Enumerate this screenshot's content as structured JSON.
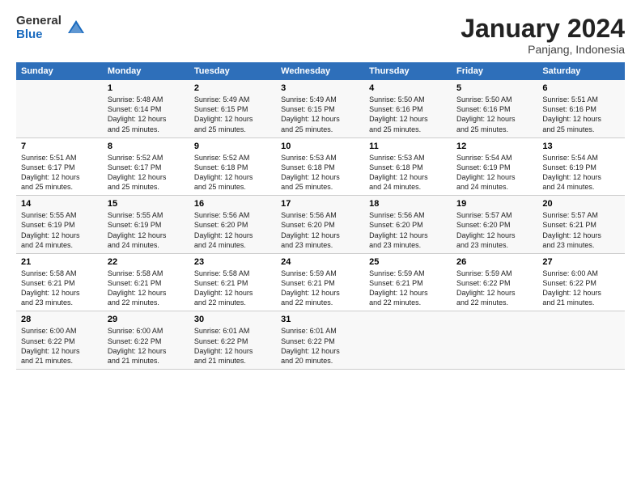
{
  "logo": {
    "general": "General",
    "blue": "Blue"
  },
  "title": "January 2024",
  "subtitle": "Panjang, Indonesia",
  "days_header": [
    "Sunday",
    "Monday",
    "Tuesday",
    "Wednesday",
    "Thursday",
    "Friday",
    "Saturday"
  ],
  "weeks": [
    [
      {
        "num": "",
        "info": ""
      },
      {
        "num": "1",
        "info": "Sunrise: 5:48 AM\nSunset: 6:14 PM\nDaylight: 12 hours\nand 25 minutes."
      },
      {
        "num": "2",
        "info": "Sunrise: 5:49 AM\nSunset: 6:15 PM\nDaylight: 12 hours\nand 25 minutes."
      },
      {
        "num": "3",
        "info": "Sunrise: 5:49 AM\nSunset: 6:15 PM\nDaylight: 12 hours\nand 25 minutes."
      },
      {
        "num": "4",
        "info": "Sunrise: 5:50 AM\nSunset: 6:16 PM\nDaylight: 12 hours\nand 25 minutes."
      },
      {
        "num": "5",
        "info": "Sunrise: 5:50 AM\nSunset: 6:16 PM\nDaylight: 12 hours\nand 25 minutes."
      },
      {
        "num": "6",
        "info": "Sunrise: 5:51 AM\nSunset: 6:16 PM\nDaylight: 12 hours\nand 25 minutes."
      }
    ],
    [
      {
        "num": "7",
        "info": "Sunrise: 5:51 AM\nSunset: 6:17 PM\nDaylight: 12 hours\nand 25 minutes."
      },
      {
        "num": "8",
        "info": "Sunrise: 5:52 AM\nSunset: 6:17 PM\nDaylight: 12 hours\nand 25 minutes."
      },
      {
        "num": "9",
        "info": "Sunrise: 5:52 AM\nSunset: 6:18 PM\nDaylight: 12 hours\nand 25 minutes."
      },
      {
        "num": "10",
        "info": "Sunrise: 5:53 AM\nSunset: 6:18 PM\nDaylight: 12 hours\nand 25 minutes."
      },
      {
        "num": "11",
        "info": "Sunrise: 5:53 AM\nSunset: 6:18 PM\nDaylight: 12 hours\nand 24 minutes."
      },
      {
        "num": "12",
        "info": "Sunrise: 5:54 AM\nSunset: 6:19 PM\nDaylight: 12 hours\nand 24 minutes."
      },
      {
        "num": "13",
        "info": "Sunrise: 5:54 AM\nSunset: 6:19 PM\nDaylight: 12 hours\nand 24 minutes."
      }
    ],
    [
      {
        "num": "14",
        "info": "Sunrise: 5:55 AM\nSunset: 6:19 PM\nDaylight: 12 hours\nand 24 minutes."
      },
      {
        "num": "15",
        "info": "Sunrise: 5:55 AM\nSunset: 6:19 PM\nDaylight: 12 hours\nand 24 minutes."
      },
      {
        "num": "16",
        "info": "Sunrise: 5:56 AM\nSunset: 6:20 PM\nDaylight: 12 hours\nand 24 minutes."
      },
      {
        "num": "17",
        "info": "Sunrise: 5:56 AM\nSunset: 6:20 PM\nDaylight: 12 hours\nand 23 minutes."
      },
      {
        "num": "18",
        "info": "Sunrise: 5:56 AM\nSunset: 6:20 PM\nDaylight: 12 hours\nand 23 minutes."
      },
      {
        "num": "19",
        "info": "Sunrise: 5:57 AM\nSunset: 6:20 PM\nDaylight: 12 hours\nand 23 minutes."
      },
      {
        "num": "20",
        "info": "Sunrise: 5:57 AM\nSunset: 6:21 PM\nDaylight: 12 hours\nand 23 minutes."
      }
    ],
    [
      {
        "num": "21",
        "info": "Sunrise: 5:58 AM\nSunset: 6:21 PM\nDaylight: 12 hours\nand 23 minutes."
      },
      {
        "num": "22",
        "info": "Sunrise: 5:58 AM\nSunset: 6:21 PM\nDaylight: 12 hours\nand 22 minutes."
      },
      {
        "num": "23",
        "info": "Sunrise: 5:58 AM\nSunset: 6:21 PM\nDaylight: 12 hours\nand 22 minutes."
      },
      {
        "num": "24",
        "info": "Sunrise: 5:59 AM\nSunset: 6:21 PM\nDaylight: 12 hours\nand 22 minutes."
      },
      {
        "num": "25",
        "info": "Sunrise: 5:59 AM\nSunset: 6:21 PM\nDaylight: 12 hours\nand 22 minutes."
      },
      {
        "num": "26",
        "info": "Sunrise: 5:59 AM\nSunset: 6:22 PM\nDaylight: 12 hours\nand 22 minutes."
      },
      {
        "num": "27",
        "info": "Sunrise: 6:00 AM\nSunset: 6:22 PM\nDaylight: 12 hours\nand 21 minutes."
      }
    ],
    [
      {
        "num": "28",
        "info": "Sunrise: 6:00 AM\nSunset: 6:22 PM\nDaylight: 12 hours\nand 21 minutes."
      },
      {
        "num": "29",
        "info": "Sunrise: 6:00 AM\nSunset: 6:22 PM\nDaylight: 12 hours\nand 21 minutes."
      },
      {
        "num": "30",
        "info": "Sunrise: 6:01 AM\nSunset: 6:22 PM\nDaylight: 12 hours\nand 21 minutes."
      },
      {
        "num": "31",
        "info": "Sunrise: 6:01 AM\nSunset: 6:22 PM\nDaylight: 12 hours\nand 20 minutes."
      },
      {
        "num": "",
        "info": ""
      },
      {
        "num": "",
        "info": ""
      },
      {
        "num": "",
        "info": ""
      }
    ]
  ]
}
